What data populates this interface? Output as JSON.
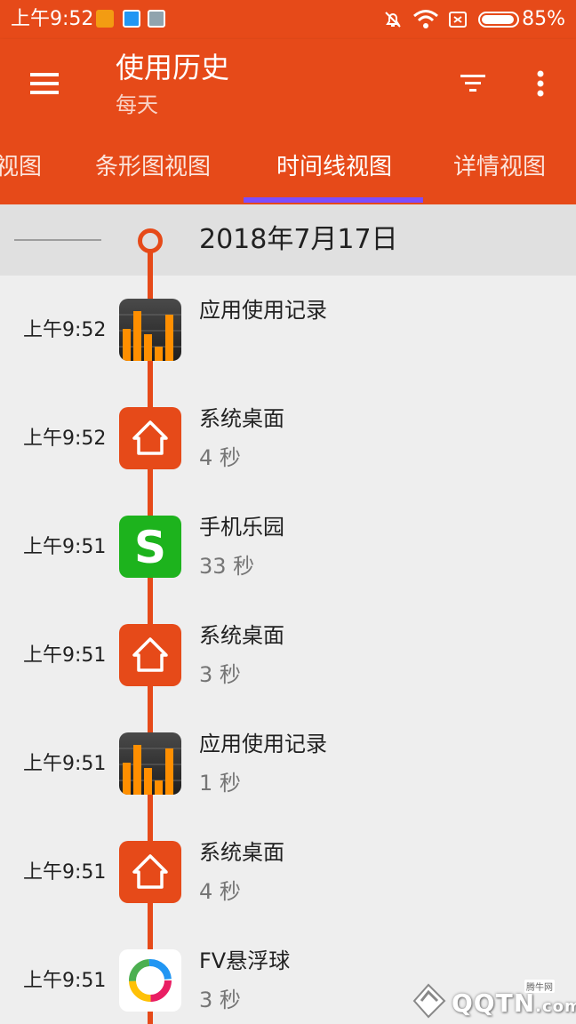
{
  "status_bar": {
    "time": "上午9:52",
    "battery": "85%"
  },
  "header": {
    "title": "使用历史",
    "subtitle": "每天"
  },
  "tabs": [
    {
      "label": "视图"
    },
    {
      "label": "条形图视图"
    },
    {
      "label": "时间线视图"
    },
    {
      "label": "详情视图"
    }
  ],
  "active_tab": "时间线视图",
  "timeline": {
    "date": "2018年7月17日",
    "entries": [
      {
        "time": "上午9:52",
        "app": "应用使用记录",
        "duration": "",
        "icon": "usage-chart-icon"
      },
      {
        "time": "上午9:52",
        "app": "系统桌面",
        "duration": "4 秒",
        "icon": "home-icon"
      },
      {
        "time": "上午9:51",
        "app": "手机乐园",
        "duration": "33 秒",
        "icon": "s-app-icon"
      },
      {
        "time": "上午9:51",
        "app": "系统桌面",
        "duration": "3 秒",
        "icon": "home-icon"
      },
      {
        "time": "上午9:51",
        "app": "应用使用记录",
        "duration": "1 秒",
        "icon": "usage-chart-icon"
      },
      {
        "time": "上午9:51",
        "app": "系统桌面",
        "duration": "4 秒",
        "icon": "home-icon"
      },
      {
        "time": "上午9:51",
        "app": "FV悬浮球",
        "duration": "3 秒",
        "icon": "fv-ring-icon"
      }
    ]
  },
  "watermark": {
    "text": "QQTN",
    "suffix": ".com",
    "small": "腾牛网"
  },
  "colors": {
    "primary": "#e64a19",
    "tab_indicator": "#7c4dff",
    "background": "#eeeeee"
  }
}
